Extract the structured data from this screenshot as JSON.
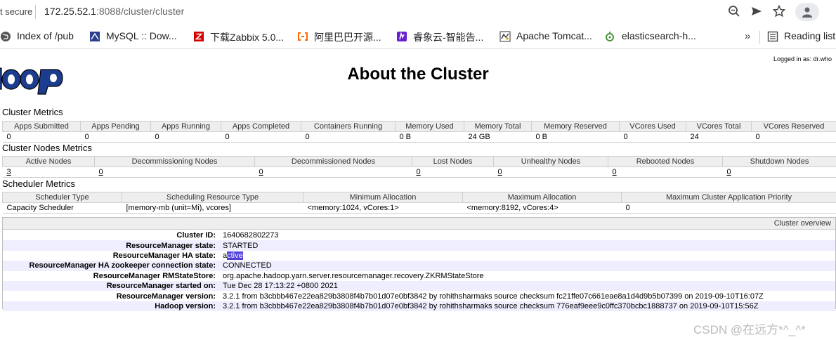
{
  "browser": {
    "security": "t secure",
    "url_host": "172.25.52.1",
    "url_rest": ":8088/cluster/cluster",
    "bookmarks": [
      {
        "label": "Index of /pub",
        "icon": "globe-icon"
      },
      {
        "label": "MySQL :: Dow...",
        "icon": "mysql-icon"
      },
      {
        "label": "下载Zabbix 5.0...",
        "icon": "zabbix-icon"
      },
      {
        "label": "阿里巴巴开源...",
        "icon": "alibaba-icon"
      },
      {
        "label": "睿象云-智能告...",
        "icon": "ruixiang-icon"
      },
      {
        "label": "Apache Tomcat...",
        "icon": "tomcat-icon"
      },
      {
        "label": "elasticsearch-h...",
        "icon": "elasticsearch-icon"
      }
    ],
    "more": "»",
    "reading_list": "Reading list"
  },
  "page": {
    "logged_in": "Logged in as: dr.who",
    "title": "About the Cluster"
  },
  "cluster_metrics": {
    "title": "Cluster Metrics",
    "headers": [
      "Apps Submitted",
      "Apps Pending",
      "Apps Running",
      "Apps Completed",
      "Containers Running",
      "Memory Used",
      "Memory Total",
      "Memory Reserved",
      "VCores Used",
      "VCores Total",
      "VCores Reserved"
    ],
    "values": [
      "0",
      "0",
      "0",
      "0",
      "0",
      "0 B",
      "24 GB",
      "0 B",
      "0",
      "24",
      "0"
    ]
  },
  "nodes_metrics": {
    "title": "Cluster Nodes Metrics",
    "headers": [
      "Active Nodes",
      "Decommissioning Nodes",
      "Decommissioned Nodes",
      "Lost Nodes",
      "Unhealthy Nodes",
      "Rebooted Nodes",
      "Shutdown Nodes"
    ],
    "values": [
      "3",
      "0",
      "0",
      "0",
      "0",
      "0",
      "0"
    ]
  },
  "scheduler_metrics": {
    "title": "Scheduler Metrics",
    "headers": [
      "Scheduler Type",
      "Scheduling Resource Type",
      "Minimum Allocation",
      "Maximum Allocation",
      "Maximum Cluster Application Priority"
    ],
    "values": [
      "Capacity Scheduler",
      "[memory-mb (unit=Mi), vcores]",
      "<memory:1024, vCores:1>",
      "<memory:8192, vCores:4>",
      "0"
    ]
  },
  "overview": {
    "header": "Cluster overview",
    "rows": [
      {
        "label": "Cluster ID:",
        "value": "1640682802273"
      },
      {
        "label": "ResourceManager state:",
        "value": "STARTED"
      },
      {
        "label": "ResourceManager HA state:",
        "value_prefix": "a",
        "value_highlight": "ctive"
      },
      {
        "label": "ResourceManager HA zookeeper connection state:",
        "value": "CONNECTED"
      },
      {
        "label": "ResourceManager RMStateStore:",
        "value": "org.apache.hadoop.yarn.server.resourcemanager.recovery.ZKRMStateStore"
      },
      {
        "label": "ResourceManager started on:",
        "value": "Tue Dec 28 17:13:22 +0800 2021"
      },
      {
        "label": "ResourceManager version:",
        "value": "3.2.1 from b3cbbb467e22ea829b3808f4b7b01d07e0bf3842 by rohithsharmaks source checksum fc21ffe07c661eae8a1d4d9b5b07399 on 2019-09-10T16:07Z"
      },
      {
        "label": "Hadoop version:",
        "value": "3.2.1 from b3cbbb467e22ea829b3808f4b7b01d07e0bf3842 by rohithsharmaks source checksum 776eaf9eee9c0ffc370bcbc1888737 on 2019-09-10T15:56Z"
      }
    ]
  },
  "watermark": "CSDN @在远方*^_^*",
  "colors": {
    "highlight": "#4f3fd8",
    "row_alt": "#eeeeff",
    "header_bg": "#eeeeee"
  }
}
